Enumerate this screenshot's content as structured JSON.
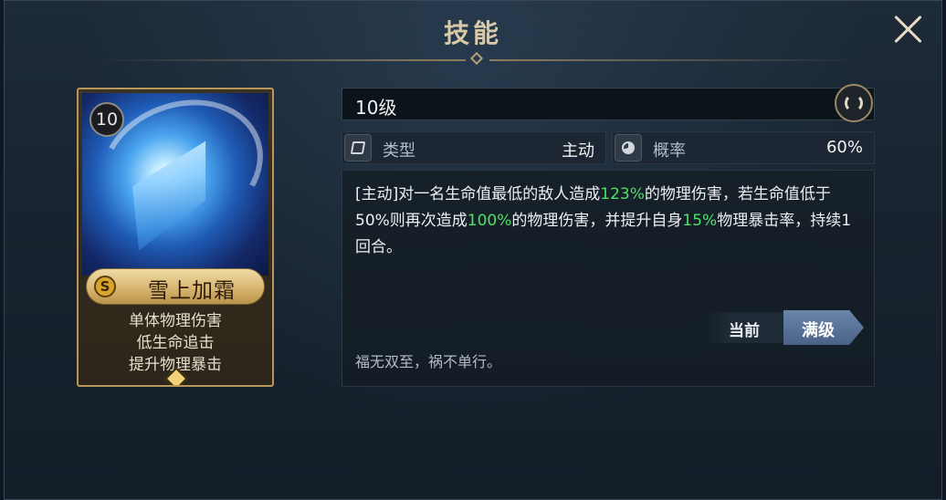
{
  "header": {
    "title": "技能"
  },
  "card": {
    "level": "10",
    "grade": "S",
    "name": "雪上加霜",
    "tags": [
      "单体物理伤害",
      "低生命追击",
      "提升物理暴击"
    ]
  },
  "detail": {
    "level_label": "10级",
    "type_label": "类型",
    "type_value": "主动",
    "prob_label": "概率",
    "prob_value": "60%",
    "desc": {
      "p1": "[主动]对一名生命值最低的敌人造成",
      "v1": "123%",
      "p2": "的物理伤害，若生命值低于50%则再次造成",
      "v2": "100%",
      "p3": "的物理伤害，并提升自身",
      "v3": "15%",
      "p4": "物理暴击率，持续1回合。"
    },
    "flavor": "福无双至，祸不单行。",
    "tab_current": "当前",
    "tab_max": "满级"
  },
  "colors": {
    "highlight": "#4fe06a",
    "gold": "#d8b670"
  },
  "icons": [
    "close-icon",
    "refresh-icon",
    "layers-icon",
    "pie-chart-icon",
    "grade-s-icon"
  ]
}
